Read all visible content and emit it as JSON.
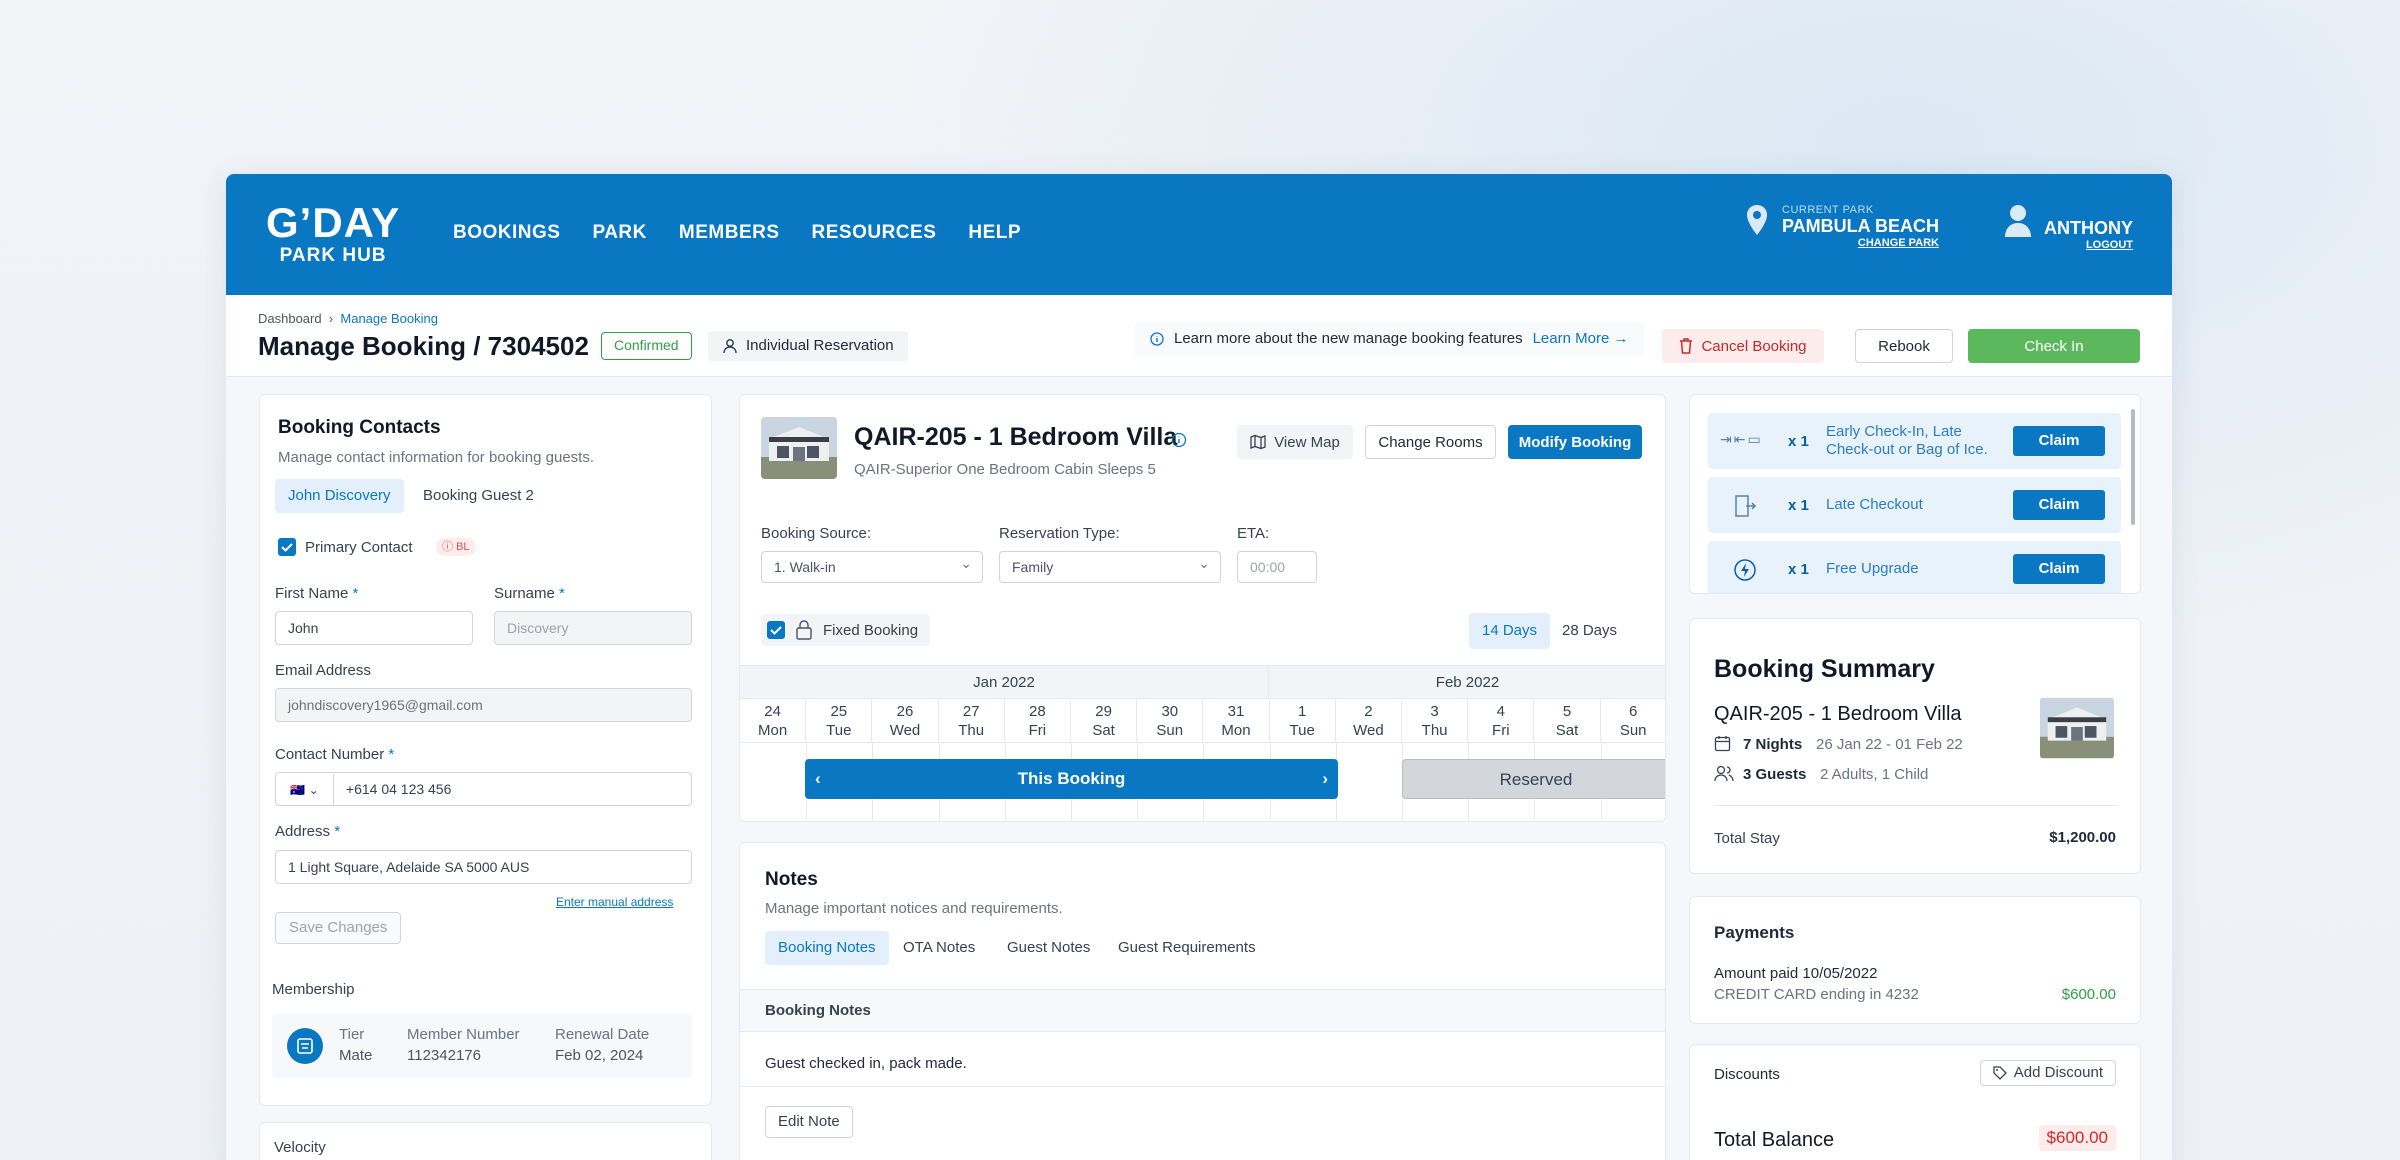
{
  "nav": {
    "logo_main": "G’DAY",
    "logo_sub": "PARK HUB",
    "items": [
      "BOOKINGS",
      "PARK",
      "MEMBERS",
      "RESOURCES",
      "HELP"
    ],
    "current_park_label": "CURRENT PARK",
    "current_park": "PAMBULA BEACH",
    "change_park": "CHANGE PARK",
    "user": "ANTHONY",
    "logout": "LOGOUT"
  },
  "header": {
    "breadcrumb_root": "Dashboard",
    "breadcrumb_current": "Manage Booking",
    "title": "Manage Booking / 7304502",
    "status": "Confirmed",
    "reservation_kind": "Individual Reservation",
    "info_text": "Learn more about the new manage booking features",
    "info_link": "Learn More →",
    "cancel": "Cancel Booking",
    "rebook": "Rebook",
    "checkin": "Check In"
  },
  "contacts": {
    "title": "Booking Contacts",
    "subtitle": "Manage contact information for booking guests.",
    "tabs": [
      "John Discovery",
      "Booking Guest 2"
    ],
    "primary": "Primary Contact",
    "bl": "BL",
    "first_label": "First Name",
    "first_value": "John",
    "surname_label": "Surname",
    "surname_placeholder": "Discovery",
    "email_label": "Email Address",
    "email_value": "johndiscovery1965@gmail.com",
    "phone_label": "Contact Number",
    "phone_value": "+614 04 123 456",
    "address_label": "Address",
    "address_value": "1 Light Square, Adelaide SA 5000 AUS",
    "manual": "Enter manual address",
    "save": "Save Changes",
    "membership_title": "Membership",
    "tier_label": "Tier",
    "tier": "Mate",
    "memnum_label": "Member Number",
    "memnum": "112342176",
    "renew_label": "Renewal Date",
    "renew": "Feb 02, 2024",
    "velocity": "Velocity"
  },
  "room": {
    "title": "QAIR-205 - 1 Bedroom Villa",
    "subtitle": "QAIR-Superior One Bedroom Cabin Sleeps 5",
    "view_map": "View Map",
    "change_rooms": "Change Rooms",
    "modify": "Modify Booking",
    "source_label": "Booking Source:",
    "source": "1. Walk-in",
    "type_label": "Reservation Type:",
    "type": "Family",
    "eta_label": "ETA:",
    "eta_placeholder": "00:00",
    "fixed": "Fixed Booking",
    "d14": "14 Days",
    "d28": "28 Days"
  },
  "calendar": {
    "months": [
      "Jan 2022",
      "Feb 2022"
    ],
    "days": [
      [
        "24",
        "Mon"
      ],
      [
        "25",
        "Tue"
      ],
      [
        "26",
        "Wed"
      ],
      [
        "27",
        "Thu"
      ],
      [
        "28",
        "Fri"
      ],
      [
        "29",
        "Sat"
      ],
      [
        "30",
        "Sun"
      ],
      [
        "31",
        "Mon"
      ],
      [
        "1",
        "Tue"
      ],
      [
        "2",
        "Wed"
      ],
      [
        "3",
        "Thu"
      ],
      [
        "4",
        "Fri"
      ],
      [
        "5",
        "Sat"
      ],
      [
        "6",
        "Sun"
      ]
    ],
    "this_booking": "This Booking",
    "reserved": "Reserved"
  },
  "notes": {
    "title": "Notes",
    "subtitle": "Manage important notices and requirements.",
    "tabs": [
      "Booking Notes",
      "OTA Notes",
      "Guest Notes",
      "Guest Requirements"
    ],
    "section": "Booking Notes",
    "text": "Guest checked in, pack made.",
    "edit": "Edit Note"
  },
  "claims": [
    {
      "qty": "x 1",
      "text": "Early Check-In, Late Check-out or Bag of Ice.",
      "btn": "Claim"
    },
    {
      "qty": "x 1",
      "text": "Late Checkout",
      "btn": "Claim"
    },
    {
      "qty": "x 1",
      "text": "Free Upgrade",
      "btn": "Claim"
    }
  ],
  "summary": {
    "title": "Booking Summary",
    "room": "QAIR-205 - 1 Bedroom Villa",
    "nights": "7 Nights",
    "dates": "26 Jan 22 - 01 Feb 22",
    "guests": "3 Guests",
    "guest_detail": "2 Adults, 1 Child",
    "total_label": "Total Stay",
    "total": "$1,200.00"
  },
  "payments": {
    "title": "Payments",
    "paid": "Amount paid 10/05/2022",
    "card": "CREDIT CARD ending in 4232",
    "amount": "$600.00"
  },
  "discounts": {
    "title": "Discounts",
    "add": "Add Discount",
    "balance_label": "Total Balance",
    "balance": "$600.00"
  },
  "colors": {
    "brand": "#0a77c2",
    "success": "#5cb85c",
    "danger": "#dc2626"
  }
}
